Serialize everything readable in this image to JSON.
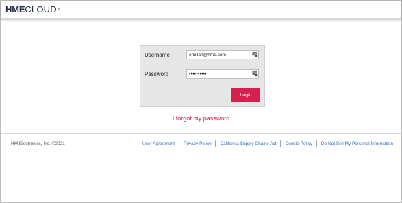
{
  "header": {
    "logo_brand": "HME",
    "logo_product": "CLOUD",
    "logo_reg": "®"
  },
  "login": {
    "username_label": "Username",
    "username_value": "emillan@hme.com",
    "password_label": "Password",
    "password_value": "••••••••••",
    "login_button": "Login"
  },
  "forgot_link": "I forgot my password",
  "footer": {
    "copyright": "HM Electronics, Inc. ©2021",
    "links": [
      "User Agreement",
      "Privacy Policy",
      "California Supply Chains Act",
      "Cookie Policy",
      "Do Not Sell My Personal Information"
    ]
  },
  "colors": {
    "accent": "#d6204d",
    "link": "#2c6fb3",
    "logo": "#1f2a44"
  }
}
